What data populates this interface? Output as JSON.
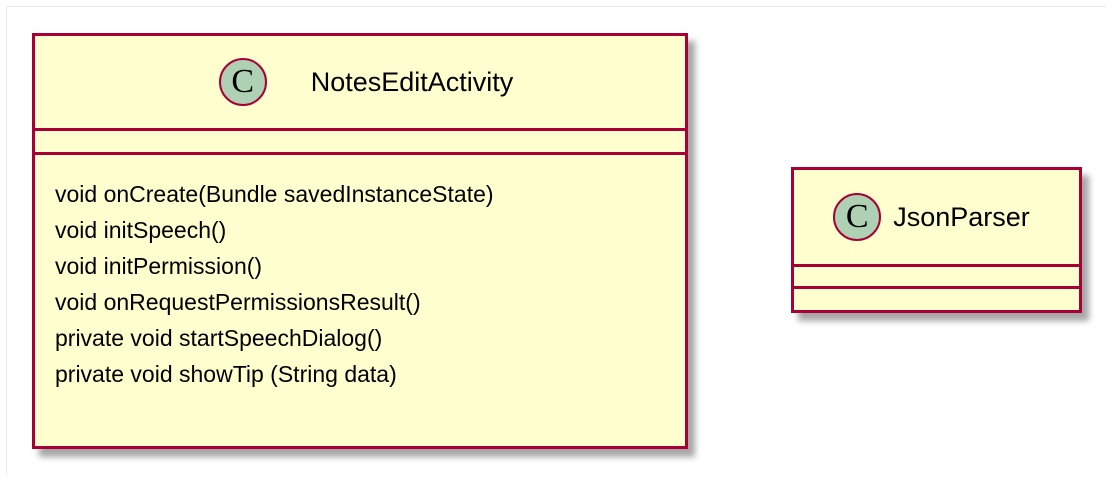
{
  "diagram": {
    "classes": [
      {
        "id": "notes",
        "stereotype_letter": "C",
        "name": "NotesEditActivity",
        "fields": [],
        "methods": [
          "void onCreate(Bundle savedInstanceState)",
          "void initSpeech()",
          "void initPermission()",
          "void onRequestPermissionsResult()",
          "private void startSpeechDialog()",
          "private void showTip (String data)"
        ]
      },
      {
        "id": "json",
        "stereotype_letter": "C",
        "name": "JsonParser",
        "fields": [],
        "methods": []
      }
    ],
    "colors": {
      "class_fill": "#fefece",
      "class_border": "#a80036",
      "stereotype_circle": "#add1b2"
    }
  }
}
